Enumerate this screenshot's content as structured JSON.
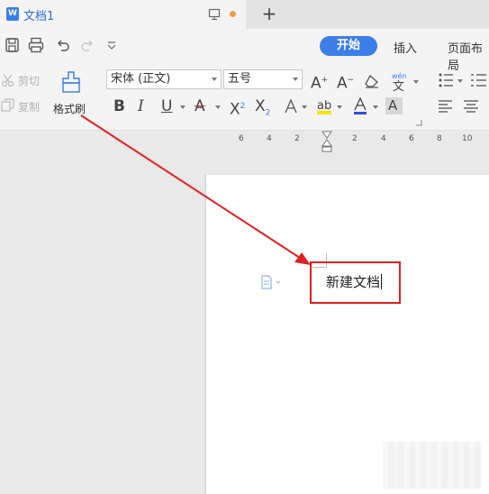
{
  "tab": {
    "icon_letter": "W",
    "title": "文档1"
  },
  "ribbon": {
    "tabs": [
      "开始",
      "插入",
      "页面布局"
    ]
  },
  "clipboard": {
    "cut_label": "剪切",
    "copy_label": "复制",
    "format_painter_label": "格式刷"
  },
  "font": {
    "family": "宋体 (正文)",
    "size": "五号"
  },
  "ruler": {
    "numbers": [
      "6",
      "4",
      "2",
      "2",
      "4",
      "6",
      "8",
      "10"
    ]
  },
  "document": {
    "text": "新建文档"
  },
  "colors": {
    "accent": "#3d7ee9",
    "annotation": "#e02020",
    "highlight_yellow": "#f2e600",
    "font_color_red": "#e02020"
  },
  "icons": [
    "doc-icon",
    "monitor-icon",
    "plus-icon",
    "save-icon",
    "print-icon",
    "undo-icon",
    "redo-icon",
    "customize-icon",
    "scissors-icon",
    "copy-icon",
    "paint-brush-icon",
    "bold-icon",
    "italic-icon",
    "underline-icon",
    "strikethrough-icon",
    "superscript-icon",
    "subscript-icon",
    "text-effect-icon",
    "highlight-icon",
    "font-color-icon",
    "char-shading-icon",
    "grow-font-icon",
    "shrink-font-icon",
    "clear-format-icon",
    "phonetic-guide-icon",
    "bullets-icon",
    "numbering-icon",
    "align-left-icon",
    "align-center-icon",
    "paragraph-icon"
  ]
}
